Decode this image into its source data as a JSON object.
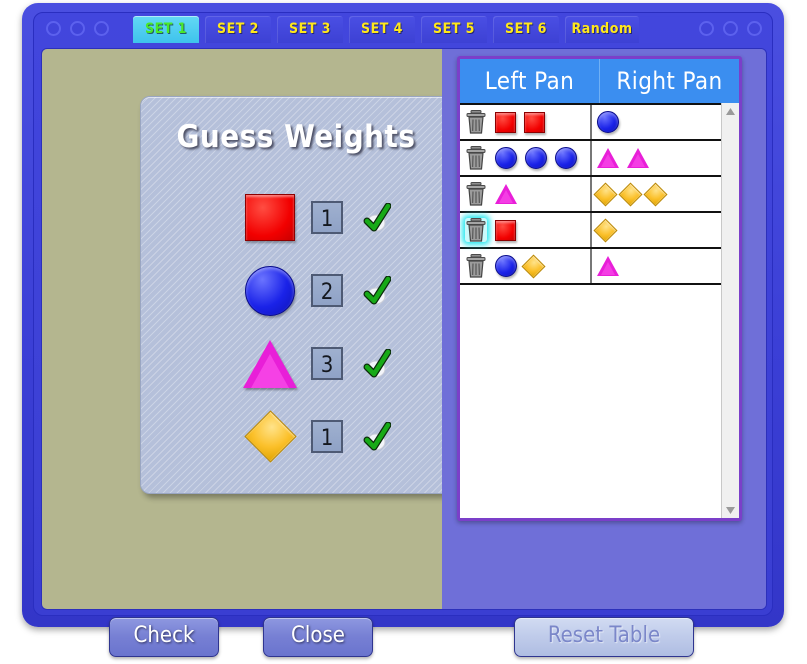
{
  "window": {
    "decorations_left": 3,
    "decorations_right": 3
  },
  "tabs": [
    {
      "label": "SET 1",
      "active": true
    },
    {
      "label": "SET 2",
      "active": false
    },
    {
      "label": "SET 3",
      "active": false
    },
    {
      "label": "SET 4",
      "active": false
    },
    {
      "label": "SET 5",
      "active": false
    },
    {
      "label": "SET 6",
      "active": false
    },
    {
      "label": "Random",
      "active": false
    }
  ],
  "guess_panel": {
    "title": "Guess Weights",
    "rows": [
      {
        "shape": "square",
        "color": "#f20000",
        "value": "1",
        "status": "correct"
      },
      {
        "shape": "circle",
        "color": "#1a22e8",
        "value": "2",
        "status": "correct"
      },
      {
        "shape": "triangle",
        "color": "#e81fd8",
        "value": "3",
        "status": "correct"
      },
      {
        "shape": "diamond",
        "color": "#fbc02a",
        "value": "1",
        "status": "correct"
      }
    ]
  },
  "table": {
    "headers": [
      "Left Pan",
      "Right Pan"
    ],
    "rows": [
      {
        "delete_icon": "trash-icon",
        "delete_hover": false,
        "left": [
          {
            "shape": "square",
            "color": "#f20000"
          },
          {
            "shape": "square",
            "color": "#f20000"
          }
        ],
        "right": [
          {
            "shape": "circle",
            "color": "#1a22e8"
          }
        ]
      },
      {
        "delete_icon": "trash-icon",
        "delete_hover": false,
        "left": [
          {
            "shape": "circle",
            "color": "#1a22e8"
          },
          {
            "shape": "circle",
            "color": "#1a22e8"
          },
          {
            "shape": "circle",
            "color": "#1a22e8"
          }
        ],
        "right": [
          {
            "shape": "triangle",
            "color": "#e81fd8"
          },
          {
            "shape": "triangle",
            "color": "#e81fd8"
          }
        ]
      },
      {
        "delete_icon": "trash-icon",
        "delete_hover": false,
        "left": [
          {
            "shape": "triangle",
            "color": "#e81fd8"
          }
        ],
        "right": [
          {
            "shape": "diamond",
            "color": "#fbc02a"
          },
          {
            "shape": "diamond",
            "color": "#fbc02a"
          },
          {
            "shape": "diamond",
            "color": "#fbc02a"
          }
        ]
      },
      {
        "delete_icon": "trash-icon",
        "delete_hover": true,
        "left": [
          {
            "shape": "square",
            "color": "#f20000"
          }
        ],
        "right": [
          {
            "shape": "diamond",
            "color": "#fbc02a"
          }
        ]
      },
      {
        "delete_icon": "trash-icon",
        "delete_hover": false,
        "left": [
          {
            "shape": "circle",
            "color": "#1a22e8"
          },
          {
            "shape": "diamond",
            "color": "#fbc02a"
          }
        ],
        "right": [
          {
            "shape": "triangle",
            "color": "#e81fd8"
          }
        ]
      }
    ],
    "empty_rows": 9,
    "scrollbar": {
      "up_arrow": "caret-up-icon",
      "down_arrow": "caret-down-icon"
    }
  },
  "buttons": {
    "check": "Check",
    "close": "Close",
    "reset_table": "Reset Table",
    "reset_enabled": false
  },
  "colors": {
    "frame": "#3b3fd6",
    "active_tab_bg": "#3ec3ec",
    "active_tab_text": "#4ae82a",
    "tab_text": "#ffe71a",
    "left_pane_bg": "#b4b68f",
    "right_pane_bg": "#6f6fd8",
    "card_bg": "#b5c0da",
    "table_header_bg": "#3b8ef0",
    "table_border": "#7b3fc9",
    "hover_glow": "#2ce8f0"
  }
}
